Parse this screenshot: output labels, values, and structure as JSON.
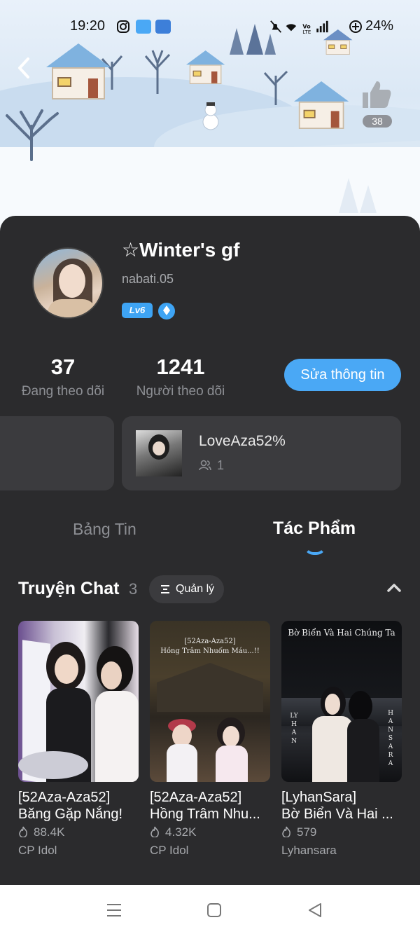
{
  "status_bar": {
    "time": "19:20",
    "battery": "24%"
  },
  "header": {
    "likes": "38"
  },
  "profile": {
    "name": "☆Winter's gf",
    "handle": "nabati.05",
    "level": "Lv6",
    "following_count": "37",
    "following_label": "Đang theo dõi",
    "followers_count": "1241",
    "followers_label": "Người theo dõi",
    "edit_label": "Sửa thông tin"
  },
  "fandom": {
    "title": "LoveAza52%",
    "members": "1"
  },
  "tabs": [
    {
      "label": "Bảng Tin"
    },
    {
      "label": "Tác Phẩm"
    }
  ],
  "section": {
    "title": "Truyện Chat",
    "count": "3",
    "manage_label": "Quản lý"
  },
  "stories": [
    {
      "title_line1": "[52Aza-Aza52]",
      "title_line2": "Băng Gặp Nắng!",
      "views": "88.4K",
      "category": "CP  Idol"
    },
    {
      "title_line1": "[52Aza-Aza52]",
      "title_line2": "Hồng Trâm Nhu...",
      "views": "4.32K",
      "category": "CP  Idol",
      "cover_line1": "[52Aza-Aza52]",
      "cover_line2": "Hồng Trâm Nhuốm Máu...!!"
    },
    {
      "title_line1": "[LyhanSara]",
      "title_line2": "Bờ Biển Và Hai ...",
      "views": "579",
      "category": "Lyhansara",
      "cover_title": "Bờ Biển Và Hai Chúng Ta",
      "cover_left": "LYHAN",
      "cover_right": "HANSARA"
    }
  ],
  "colors": {
    "accent": "#4aa8f5",
    "card_bg": "#2b2b2d",
    "tile_bg": "#3b3b3e"
  }
}
